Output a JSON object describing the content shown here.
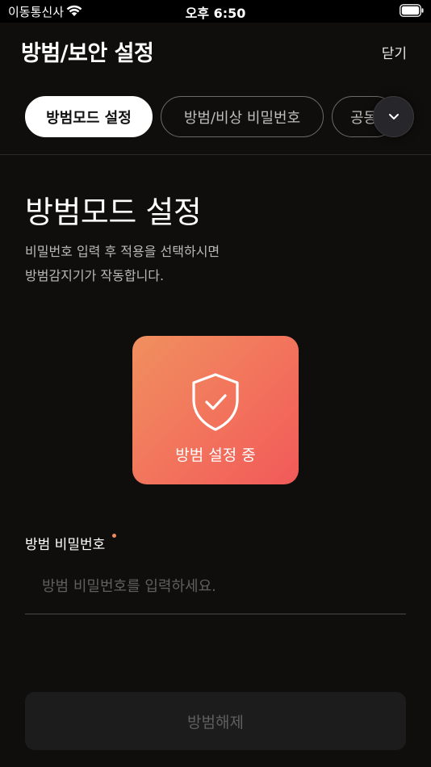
{
  "status_bar": {
    "carrier": "이동통신사",
    "time": "오후 6:50"
  },
  "header": {
    "title": "방범/보안 설정",
    "close_label": "닫기"
  },
  "tabs": [
    {
      "label": "방범모드 설정",
      "active": true
    },
    {
      "label": "방범/비상 비밀번호",
      "active": false
    },
    {
      "label": "공동",
      "active": false
    }
  ],
  "section": {
    "title": "방범모드 설정",
    "description_line1": "비밀번호 입력 후 적용을 선택하시면",
    "description_line2": "방범감지기가 작동합니다."
  },
  "status_card": {
    "text": "방범 설정 중",
    "icon": "shield-check-icon",
    "gradient_start": "#f0905f",
    "gradient_end": "#f15a59"
  },
  "password_field": {
    "label": "방범 비밀번호",
    "placeholder": "방범 비밀번호를 입력하세요.",
    "value": ""
  },
  "release_button": {
    "label": "방범해제"
  },
  "colors": {
    "background": "#0f0e0c",
    "accent": "#f08a5d"
  }
}
